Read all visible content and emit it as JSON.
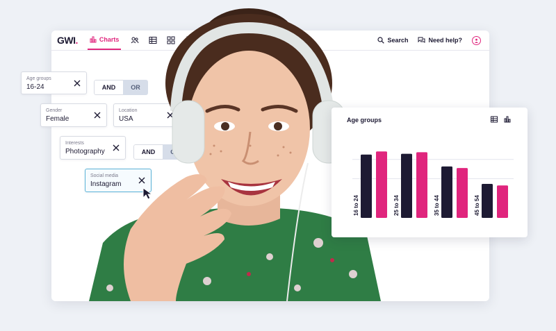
{
  "app": {
    "logo_text": "GWI",
    "logo_dot": ".",
    "charts_tab": "Charts",
    "search_label": "Search",
    "help_label": "Need help?",
    "accent": "#e0257d",
    "dark": "#1d1a33"
  },
  "filters": {
    "age": {
      "label": "Age groups",
      "value": "16-24"
    },
    "gender": {
      "label": "Gender",
      "value": "Female"
    },
    "location": {
      "label": "Location",
      "value": "USA"
    },
    "interests": {
      "label": "Interests",
      "value": "Photography"
    },
    "social": {
      "label": "Social media",
      "value": "Instagram"
    },
    "toggle1": {
      "and": "AND",
      "or": "OR"
    },
    "toggle2": {
      "and": "AND",
      "or": "OR"
    }
  },
  "chart_data": {
    "type": "bar",
    "title": "Age groups",
    "categories": [
      "16 to 24",
      "25 to 34",
      "35 to 44",
      "45 to 54"
    ],
    "series": [
      {
        "color": "#1d1a33",
        "values": [
          80,
          81,
          65,
          43
        ]
      },
      {
        "color": "#e0257d",
        "values": [
          84,
          83,
          63,
          41
        ]
      }
    ],
    "ylim": [
      0,
      100
    ],
    "grid": true,
    "legend": "none"
  }
}
